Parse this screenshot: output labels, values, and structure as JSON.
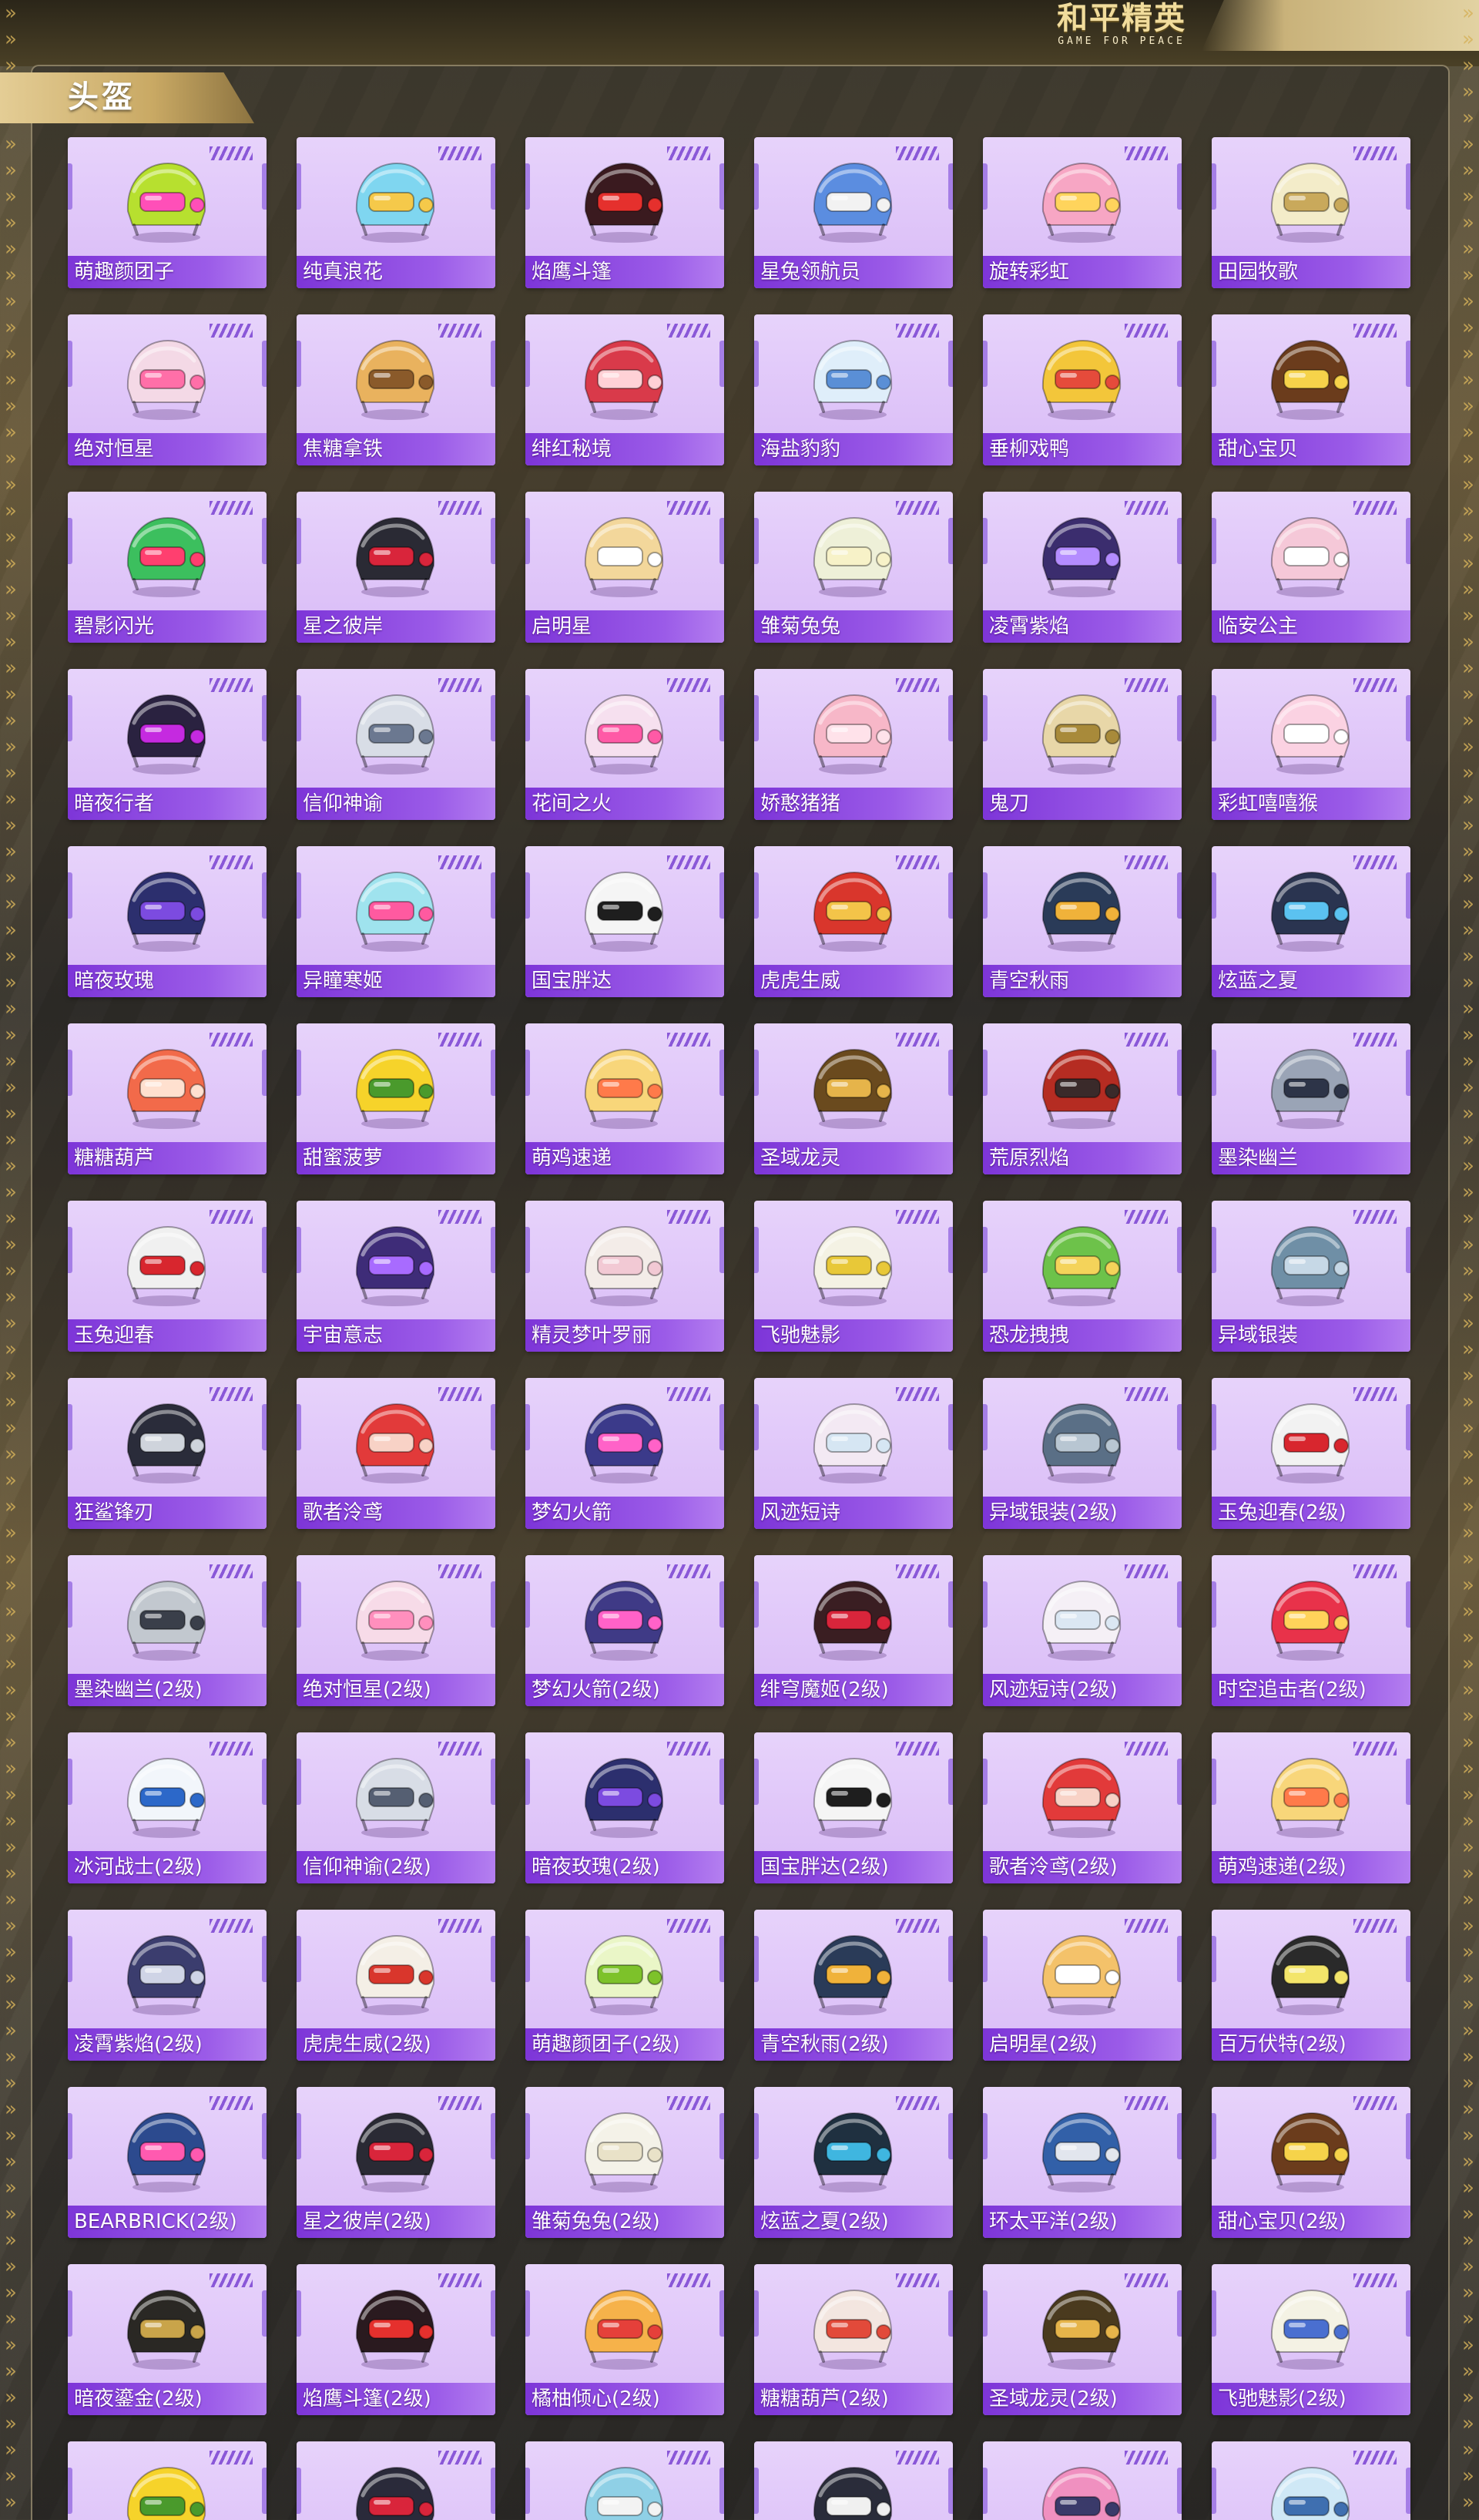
{
  "brand": {
    "logo_cn": "和平精英",
    "logo_en": "GAME FOR PEACE"
  },
  "section": {
    "title": "头盔"
  },
  "colors": {
    "card_bg": "#e2c8fa",
    "name_bar": "#8a47de",
    "section_tab": "#d6b978",
    "panel_border": "#cdbe96"
  },
  "helmets": [
    {
      "name": "萌趣颜团子",
      "icon": "helmet-icon",
      "color": "#b7e02f",
      "accent": "#ff4fb8"
    },
    {
      "name": "纯真浪花",
      "icon": "helmet-icon",
      "color": "#7fd6f0",
      "accent": "#f5c94a"
    },
    {
      "name": "焰鹰斗篷",
      "icon": "helmet-icon",
      "color": "#3a1a1f",
      "accent": "#e5302d"
    },
    {
      "name": "星兔领航员",
      "icon": "helmet-icon",
      "color": "#5b8de0",
      "accent": "#f2f2f2"
    },
    {
      "name": "旋转彩虹",
      "icon": "helmet-icon",
      "color": "#f7a6c4",
      "accent": "#ffd45c"
    },
    {
      "name": "田园牧歌",
      "icon": "helmet-icon",
      "color": "#f3ecc9",
      "accent": "#c9a95b"
    },
    {
      "name": "绝对恒星",
      "icon": "helmet-icon",
      "color": "#f4d9e6",
      "accent": "#ff6fa8"
    },
    {
      "name": "焦糖拿铁",
      "icon": "helmet-icon",
      "color": "#e9b25e",
      "accent": "#8a5a2a"
    },
    {
      "name": "绯红秘境",
      "icon": "helmet-icon",
      "color": "#d93a4a",
      "accent": "#ffd1d6"
    },
    {
      "name": "海盐豹豹",
      "icon": "helmet-icon",
      "color": "#dfeefa",
      "accent": "#5a8fd6"
    },
    {
      "name": "垂柳戏鸭",
      "icon": "helmet-icon",
      "color": "#f3c63a",
      "accent": "#e54b3b"
    },
    {
      "name": "甜心宝贝",
      "icon": "helmet-icon",
      "color": "#6b3c1c",
      "accent": "#f6d34a"
    },
    {
      "name": "碧影闪光",
      "icon": "helmet-icon",
      "color": "#3cbf5e",
      "accent": "#ff3f6f"
    },
    {
      "name": "星之彼岸",
      "icon": "helmet-icon",
      "color": "#2a2a34",
      "accent": "#d9253b"
    },
    {
      "name": "启明星",
      "icon": "helmet-icon",
      "color": "#f3d79b",
      "accent": "#ffffff"
    },
    {
      "name": "雏菊兔兔",
      "icon": "helmet-icon",
      "color": "#eef0d8",
      "accent": "#f7f2c8"
    },
    {
      "name": "凌霄紫焰",
      "icon": "helmet-icon",
      "color": "#3b2d6e",
      "accent": "#b48cff"
    },
    {
      "name": "临安公主",
      "icon": "helmet-icon",
      "color": "#f5c8d8",
      "accent": "#ffffff"
    },
    {
      "name": "暗夜行者",
      "icon": "helmet-icon",
      "color": "#2a2240",
      "accent": "#c52ae0"
    },
    {
      "name": "信仰神谕",
      "icon": "helmet-icon",
      "color": "#d8dde6",
      "accent": "#6b7890"
    },
    {
      "name": "花间之火",
      "icon": "helmet-icon",
      "color": "#f6e0ef",
      "accent": "#ff5aa6"
    },
    {
      "name": "娇憨猪猪",
      "icon": "helmet-icon",
      "color": "#f7b7c8",
      "accent": "#ffe2ea"
    },
    {
      "name": "鬼刀",
      "icon": "helmet-icon",
      "color": "#e8d7a8",
      "accent": "#a88a3a"
    },
    {
      "name": "彩虹嘻嘻猴",
      "icon": "helmet-icon",
      "color": "#fbd2e2",
      "accent": "#ffffff"
    },
    {
      "name": "暗夜玫瑰",
      "icon": "helmet-icon",
      "color": "#2c2f6e",
      "accent": "#7c4be0"
    },
    {
      "name": "异瞳寒姬",
      "icon": "helmet-icon",
      "color": "#9fe3ee",
      "accent": "#ff5aa0"
    },
    {
      "name": "国宝胖达",
      "icon": "helmet-icon",
      "color": "#f5f5f5",
      "accent": "#1e1e1e"
    },
    {
      "name": "虎虎生威",
      "icon": "helmet-icon",
      "color": "#d9362c",
      "accent": "#f3c449"
    },
    {
      "name": "青空秋雨",
      "icon": "helmet-icon",
      "color": "#2a3b58",
      "accent": "#f0b23a"
    },
    {
      "name": "炫蓝之夏",
      "icon": "helmet-icon",
      "color": "#2a3450",
      "accent": "#5bc2f0"
    },
    {
      "name": "糖糖葫芦",
      "icon": "helmet-icon",
      "color": "#f26a4a",
      "accent": "#ffe0cf"
    },
    {
      "name": "甜蜜菠萝",
      "icon": "helmet-icon",
      "color": "#f6d32a",
      "accent": "#4a9a2c"
    },
    {
      "name": "萌鸡速递",
      "icon": "helmet-icon",
      "color": "#f8d67a",
      "accent": "#ff7a4a"
    },
    {
      "name": "圣域龙灵",
      "icon": "helmet-icon",
      "color": "#6a4a1e",
      "accent": "#e6b44a"
    },
    {
      "name": "荒原烈焰",
      "icon": "helmet-icon",
      "color": "#b52c22",
      "accent": "#3a2a2a"
    },
    {
      "name": "墨染幽兰",
      "icon": "helmet-icon",
      "color": "#9aa4b6",
      "accent": "#2d3448"
    },
    {
      "name": "玉兔迎春",
      "icon": "helmet-icon",
      "color": "#f0f0f0",
      "accent": "#d8262e"
    },
    {
      "name": "宇宙意志",
      "icon": "helmet-icon",
      "color": "#3e2c78",
      "accent": "#a86bff"
    },
    {
      "name": "精灵梦叶罗丽",
      "icon": "helmet-icon",
      "color": "#f3ece8",
      "accent": "#f2c9d4"
    },
    {
      "name": "飞驰魅影",
      "icon": "helmet-icon",
      "color": "#f4f2e4",
      "accent": "#e8c838"
    },
    {
      "name": "恐龙拽拽",
      "icon": "helmet-icon",
      "color": "#6dc24a",
      "accent": "#f4d35a"
    },
    {
      "name": "异域银装",
      "icon": "helmet-icon",
      "color": "#6f8fa6",
      "accent": "#c6d8e6"
    },
    {
      "name": "狂鲨锋刃",
      "icon": "helmet-icon",
      "color": "#2a2c3a",
      "accent": "#cfd4dc"
    },
    {
      "name": "歌者泠鸢",
      "icon": "helmet-icon",
      "color": "#e23a3a",
      "accent": "#f8d2c6"
    },
    {
      "name": "梦幻火箭",
      "icon": "helmet-icon",
      "color": "#3b3a8a",
      "accent": "#ff62c8"
    },
    {
      "name": "风迹短诗",
      "icon": "helmet-icon",
      "color": "#f3e9f3",
      "accent": "#d6e6f3"
    },
    {
      "name": "异域银装(2级)",
      "icon": "helmet-icon",
      "color": "#5a6f86",
      "accent": "#b8c6d2"
    },
    {
      "name": "玉兔迎春(2级)",
      "icon": "helmet-icon",
      "color": "#f2f2f2",
      "accent": "#d8262e"
    },
    {
      "name": "墨染幽兰(2级)",
      "icon": "helmet-icon",
      "color": "#c2c8cf",
      "accent": "#3a3f4a"
    },
    {
      "name": "绝对恒星(2级)",
      "icon": "helmet-icon",
      "color": "#f7dbe8",
      "accent": "#ff8fbd"
    },
    {
      "name": "梦幻火箭(2级)",
      "icon": "helmet-icon",
      "color": "#3f3a86",
      "accent": "#ff62c8"
    },
    {
      "name": "绯穹魔姬(2级)",
      "icon": "helmet-icon",
      "color": "#3a1e22",
      "accent": "#d9253b"
    },
    {
      "name": "风迹短诗(2级)",
      "icon": "helmet-icon",
      "color": "#f5f0f6",
      "accent": "#dbe7f3"
    },
    {
      "name": "时空追击者(2级)",
      "icon": "helmet-icon",
      "color": "#e8324a",
      "accent": "#ffd35a"
    },
    {
      "name": "冰河战士(2级)",
      "icon": "helmet-icon",
      "color": "#f2f6fb",
      "accent": "#2c68c9"
    },
    {
      "name": "信仰神谕(2级)",
      "icon": "helmet-icon",
      "color": "#d8dde6",
      "accent": "#555f72"
    },
    {
      "name": "暗夜玫瑰(2级)",
      "icon": "helmet-icon",
      "color": "#2c2f6e",
      "accent": "#7c4be0"
    },
    {
      "name": "国宝胖达(2级)",
      "icon": "helmet-icon",
      "color": "#f5f5f5",
      "accent": "#1e1e1e"
    },
    {
      "name": "歌者泠鸢(2级)",
      "icon": "helmet-icon",
      "color": "#e23a3a",
      "accent": "#f8d2c6"
    },
    {
      "name": "萌鸡速递(2级)",
      "icon": "helmet-icon",
      "color": "#f8d67a",
      "accent": "#ff7a4a"
    },
    {
      "name": "凌霄紫焰(2级)",
      "icon": "helmet-icon",
      "color": "#3b3d6e",
      "accent": "#cfd4e6"
    },
    {
      "name": "虎虎生威(2级)",
      "icon": "helmet-icon",
      "color": "#f4efe6",
      "accent": "#d9362c"
    },
    {
      "name": "萌趣颜团子(2级)",
      "icon": "helmet-icon",
      "color": "#eaf6c7",
      "accent": "#7dc22a"
    },
    {
      "name": "青空秋雨(2级)",
      "icon": "helmet-icon",
      "color": "#2a3b58",
      "accent": "#f0b23a"
    },
    {
      "name": "启明星(2级)",
      "icon": "helmet-icon",
      "color": "#f4c26a",
      "accent": "#ffffff"
    },
    {
      "name": "百万伏特(2级)",
      "icon": "helmet-icon",
      "color": "#2a2a2a",
      "accent": "#f3e56a"
    },
    {
      "name": "BEARBRICK(2级)",
      "icon": "helmet-icon",
      "color": "#2c4a8e",
      "accent": "#ff5ab0"
    },
    {
      "name": "星之彼岸(2级)",
      "icon": "helmet-icon",
      "color": "#2a2a34",
      "accent": "#d9253b"
    },
    {
      "name": "雏菊兔兔(2级)",
      "icon": "helmet-icon",
      "color": "#f4f2e8",
      "accent": "#e9e2c8"
    },
    {
      "name": "炫蓝之夏(2级)",
      "icon": "helmet-icon",
      "color": "#1f3040",
      "accent": "#3fb6e0"
    },
    {
      "name": "环太平洋(2级)",
      "icon": "helmet-icon",
      "color": "#3260a8",
      "accent": "#e2e6ee"
    },
    {
      "name": "甜心宝贝(2级)",
      "icon": "helmet-icon",
      "color": "#6b3c1c",
      "accent": "#f6d34a"
    },
    {
      "name": "暗夜鎏金(2级)",
      "icon": "helmet-icon",
      "color": "#2a2824",
      "accent": "#c9a44a"
    },
    {
      "name": "焰鹰斗篷(2级)",
      "icon": "helmet-icon",
      "color": "#2a1a1f",
      "accent": "#e5302d"
    },
    {
      "name": "橘柚倾心(2级)",
      "icon": "helmet-icon",
      "color": "#f6b24a",
      "accent": "#e5403a"
    },
    {
      "name": "糖糖葫芦(2级)",
      "icon": "helmet-icon",
      "color": "#f3e6e0",
      "accent": "#e24a3a"
    },
    {
      "name": "圣域龙灵(2级)",
      "icon": "helmet-icon",
      "color": "#4a3a1e",
      "accent": "#e6b44a"
    },
    {
      "name": "飞驰魅影(2级)",
      "icon": "helmet-icon",
      "color": "#f4f2e4",
      "accent": "#4a6fd0"
    },
    {
      "name": "",
      "icon": "helmet-icon",
      "color": "#f6d32a",
      "accent": "#4a9a2c"
    },
    {
      "name": "",
      "icon": "helmet-icon",
      "color": "#2a2a3a",
      "accent": "#d9253b"
    },
    {
      "name": "",
      "icon": "helmet-icon",
      "color": "#8fd0e6",
      "accent": "#f3f3f3"
    },
    {
      "name": "",
      "icon": "helmet-icon",
      "color": "#2a2c3a",
      "accent": "#f0f0f0"
    },
    {
      "name": "",
      "icon": "helmet-icon",
      "color": "#f090c0",
      "accent": "#3a3a6a"
    },
    {
      "name": "",
      "icon": "helmet-icon",
      "color": "#cfe8f6",
      "accent": "#3f6fb0"
    }
  ]
}
